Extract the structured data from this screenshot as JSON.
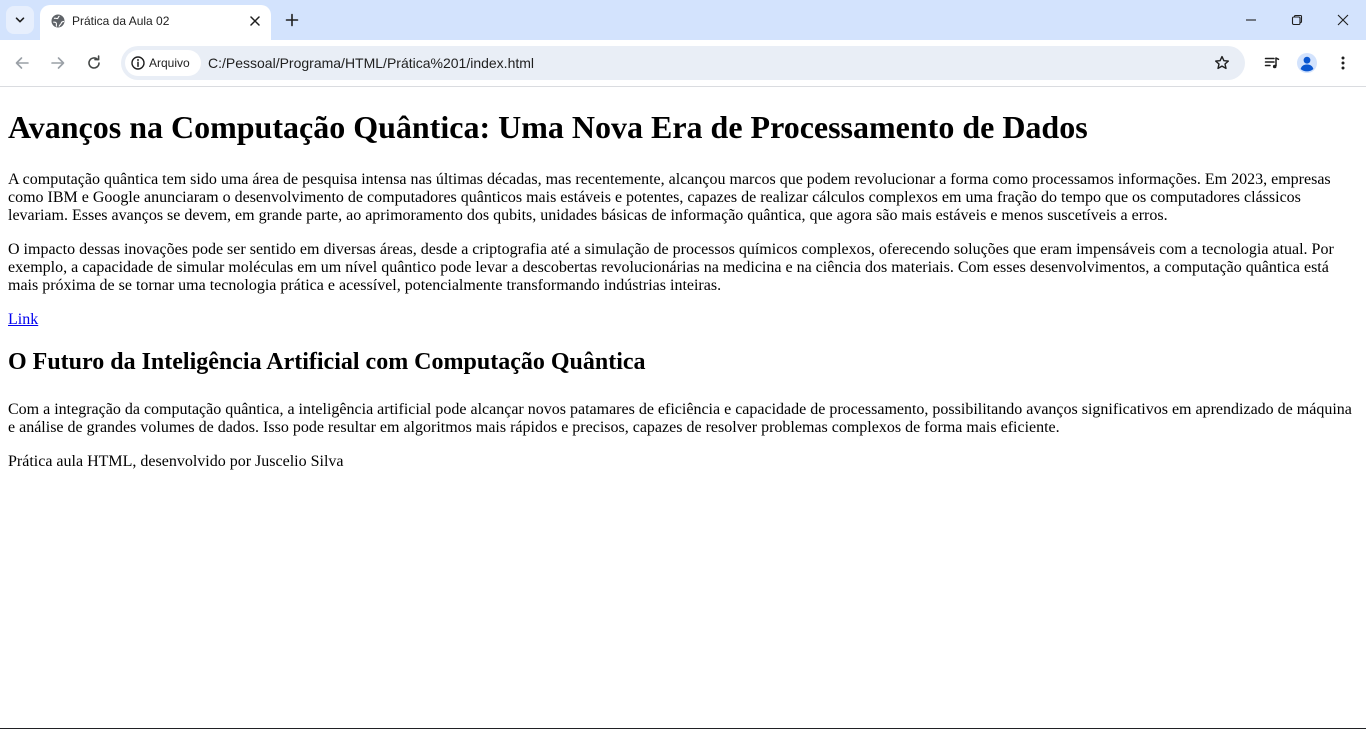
{
  "browser": {
    "tab": {
      "title": "Prática da Aula 02"
    },
    "address_bar": {
      "security_chip": "Arquivo",
      "url": "C:/Pessoal/Programa/HTML/Prática%201/index.html"
    },
    "icons": {
      "tab_search": "chevron-down-icon",
      "favicon": "globe-icon",
      "tab_close": "close-icon",
      "new_tab": "plus-icon",
      "minimize": "minimize-icon",
      "restore": "restore-icon",
      "close_window": "close-icon",
      "back": "arrow-left-icon",
      "forward": "arrow-right-icon",
      "reload": "reload-icon",
      "info": "info-icon",
      "bookmark": "star-icon",
      "media": "media-control-icon",
      "profile": "profile-icon",
      "menu": "kebab-menu-icon"
    },
    "colors": {
      "tabstrip_bg": "#d3e3fd",
      "omnibox_bg": "#e9eef6",
      "profile_accent": "#0b57d0",
      "link": "#0000ee"
    }
  },
  "page": {
    "heading": "Avanços na Computação Quântica: Uma Nova Era de Processamento de Dados",
    "paragraph_1": "A computação quântica tem sido uma área de pesquisa intensa nas últimas décadas, mas recentemente, alcançou marcos que podem revolucionar a forma como processamos informações. Em 2023, empresas como IBM e Google anunciaram o desenvolvimento de computadores quânticos mais estáveis e potentes, capazes de realizar cálculos complexos em uma fração do tempo que os computadores clássicos levariam. Esses avanços se devem, em grande parte, ao aprimoramento dos qubits, unidades básicas de informação quântica, que agora são mais estáveis e menos suscetíveis a erros.",
    "paragraph_2": "O impacto dessas inovações pode ser sentido em diversas áreas, desde a criptografia até a simulação de processos químicos complexos, oferecendo soluções que eram impensáveis com a tecnologia atual. Por exemplo, a capacidade de simular moléculas em um nível quântico pode levar a descobertas revolucionárias na medicina e na ciência dos materiais. Com esses desenvolvimentos, a computação quântica está mais próxima de se tornar uma tecnologia prática e acessível, potencialmente transformando indústrias inteiras.",
    "link_label": "Link",
    "subheading": "O Futuro da Inteligência Artificial com Computação Quântica",
    "paragraph_3": "Com a integração da computação quântica, a inteligência artificial pode alcançar novos patamares de eficiência e capacidade de processamento, possibilitando avanços significativos em aprendizado de máquina e análise de grandes volumes de dados. Isso pode resultar em algoritmos mais rápidos e precisos, capazes de resolver problemas complexos de forma mais eficiente.",
    "footer": "Prática aula HTML, desenvolvido por Juscelio Silva"
  }
}
